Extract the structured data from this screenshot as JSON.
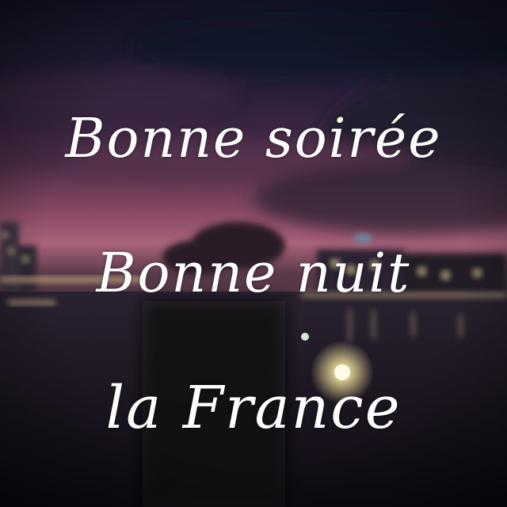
{
  "caption": {
    "line_1": "Bonne soirée",
    "line_2": "Bonne nuit",
    "line_3": "la France"
  },
  "colors": {
    "sky_top": "#1a1530",
    "sky_glow": "#7a3c5c",
    "horizon": "#b36a78",
    "water": "#1c1620",
    "text": "#ffffff"
  }
}
